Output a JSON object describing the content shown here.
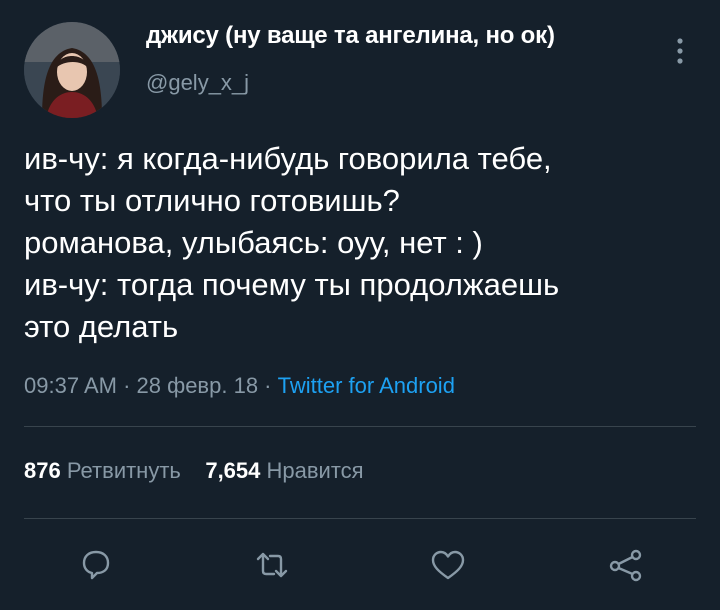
{
  "user": {
    "display_name": "джису (ну ваще та ангелина, но ок)",
    "handle": "@gely_x_j"
  },
  "tweet": {
    "lines": [
      "ив-чу: я когда-нибудь говорила тебе,",
      "что ты отлично готовишь?",
      "романова, улыбаясь: оуу, нет : )",
      "ив-чу: тогда почему ты продолжаешь",
      "это делать"
    ]
  },
  "meta": {
    "time": "09:37 AM",
    "sep1": " · ",
    "date": "28 февр. 18",
    "sep2": " · ",
    "source": "Twitter for Android"
  },
  "stats": {
    "retweets_count": "876",
    "retweets_label": "Ретвитнуть",
    "likes_count": "7,654",
    "likes_label": "Нравится"
  },
  "actions": {
    "reply_icon": "reply-icon",
    "retweet_icon": "retweet-icon",
    "like_icon": "heart-icon",
    "share_icon": "share-icon"
  },
  "colors": {
    "background": "#15202b",
    "text_secondary": "#8899a6",
    "link": "#1da1f2",
    "divider": "#38444d"
  }
}
